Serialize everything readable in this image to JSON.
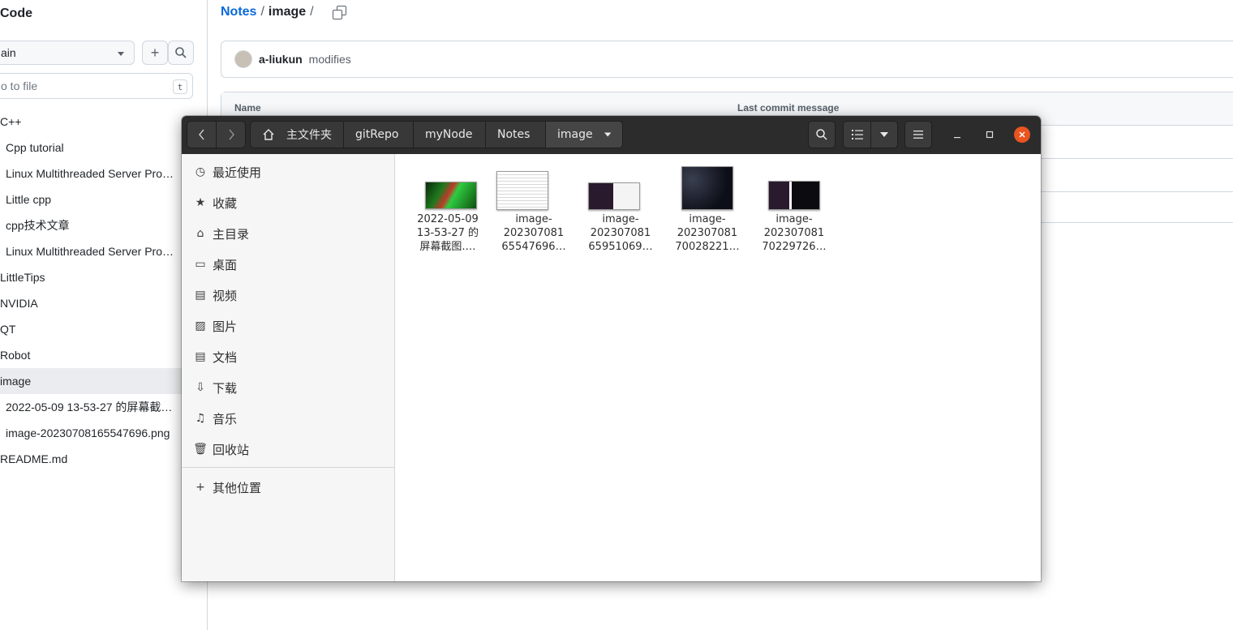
{
  "github": {
    "code_title": "Code",
    "branch": "ain",
    "goto_placeholder": "o to file",
    "goto_shortcut": "t",
    "tree": [
      {
        "label": "C++",
        "level": 0
      },
      {
        "label": "Cpp tutorial",
        "level": 1
      },
      {
        "label": "Linux Multithreaded Server Pro…",
        "level": 1
      },
      {
        "label": "Little cpp",
        "level": 1
      },
      {
        "label": "cpp技术文章",
        "level": 1
      },
      {
        "label": "Linux Multithreaded Server Pro…",
        "level": 1
      },
      {
        "label": "LittleTips",
        "level": 0
      },
      {
        "label": "NVIDIA",
        "level": 0
      },
      {
        "label": "QT",
        "level": 0
      },
      {
        "label": "Robot",
        "level": 0
      },
      {
        "label": "image",
        "level": 0,
        "active": true
      },
      {
        "label": "2022-05-09 13-53-27 的屏幕截…",
        "level": 1
      },
      {
        "label": "image-20230708165547696.png",
        "level": 1
      },
      {
        "label": "README.md",
        "level": 0
      }
    ],
    "breadcrumb": {
      "repo": "Notes",
      "sep": "/",
      "folder": "image",
      "trail": "/"
    },
    "commit": {
      "author": "a-liukun",
      "message": "modifies"
    },
    "table_headers": {
      "name": "Name",
      "last_commit": "Last commit message"
    }
  },
  "nautilus": {
    "path": [
      "主文件夹",
      "gitRepo",
      "myNode",
      "Notes",
      "image"
    ],
    "sidebar": [
      {
        "label": "最近使用",
        "icon": "clock-icon",
        "glyph": "◷"
      },
      {
        "label": "收藏",
        "icon": "star-icon",
        "glyph": "★"
      },
      {
        "label": "主目录",
        "icon": "home-icon",
        "glyph": "⌂"
      },
      {
        "label": "桌面",
        "icon": "desktop-icon",
        "glyph": "▭"
      },
      {
        "label": "视频",
        "icon": "video-icon",
        "glyph": "▤"
      },
      {
        "label": "图片",
        "icon": "picture-icon",
        "glyph": "▨"
      },
      {
        "label": "文档",
        "icon": "document-icon",
        "glyph": "▤"
      },
      {
        "label": "下载",
        "icon": "download-icon",
        "glyph": "⇩"
      },
      {
        "label": "音乐",
        "icon": "music-icon",
        "glyph": "♫"
      },
      {
        "label": "回收站",
        "icon": "trash-icon",
        "glyph": "🗑"
      }
    ],
    "other_locations": {
      "label": "其他位置",
      "icon": "plus-icon",
      "glyph": "+"
    },
    "files": [
      {
        "lines": [
          "2022-05-09",
          "13-53-27 的",
          "屏幕截图.…"
        ],
        "thumb": "green"
      },
      {
        "lines": [
          "image-",
          "202307081",
          "65547696…"
        ],
        "thumb": "text"
      },
      {
        "lines": [
          "image-",
          "202307081",
          "65951069…"
        ],
        "thumb": "dark-split"
      },
      {
        "lines": [
          "image-",
          "202307081",
          "70028221…"
        ],
        "thumb": "dark"
      },
      {
        "lines": [
          "image-",
          "202307081",
          "70229726…"
        ],
        "thumb": "dark-box"
      }
    ],
    "colors": {
      "headerbar": "#2c2c2c",
      "close": "#e95420",
      "sidebar": "#f6f6f6"
    }
  }
}
